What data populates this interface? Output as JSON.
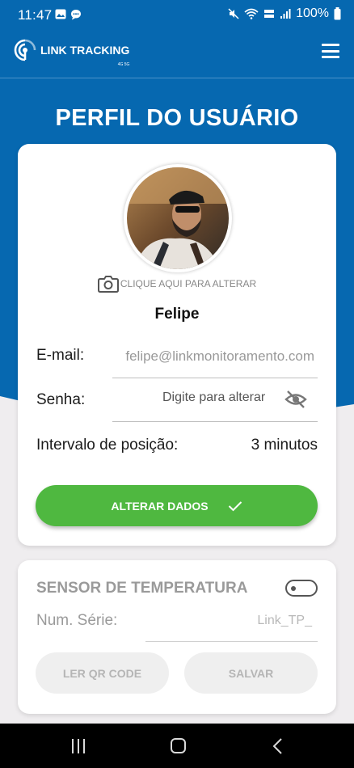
{
  "status_bar": {
    "time": "11:47",
    "battery": "100%"
  },
  "app_bar": {
    "logo_text": "LINK TRACKING",
    "logo_subtext": "4G 5G",
    "menu_icon": "hamburger-menu-icon"
  },
  "page": {
    "title": "PERFIL DO USUÁRIO"
  },
  "profile": {
    "change_photo_label": "CLIQUE AQUI PARA ALTERAR",
    "name": "Felipe",
    "email_label": "E-mail:",
    "email_value": "felipe@linkmonitoramento.com",
    "password_label": "Senha:",
    "password_placeholder": "Digite para alterar",
    "interval_label": "Intervalo de posição:",
    "interval_value": "3 minutos",
    "submit_label": "ALTERAR DADOS"
  },
  "sensor": {
    "title": "SENSOR DE TEMPERATURA",
    "enabled": false,
    "serial_label": "Num. Série:",
    "serial_placeholder": "Link_TP_",
    "read_qr_label": "LER QR CODE",
    "save_label": "SALVAR"
  },
  "colors": {
    "primary_blue": "#0668b0",
    "accent_green": "#4fb840"
  }
}
